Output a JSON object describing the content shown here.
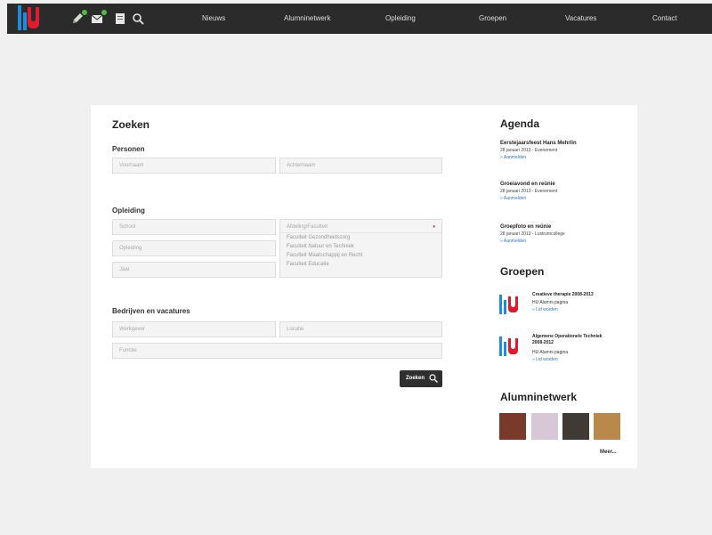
{
  "nav": {
    "logo": "hu-logo",
    "tools": [
      {
        "icon": "pencil-icon"
      },
      {
        "icon": "mail-icon"
      },
      {
        "icon": "book-icon"
      },
      {
        "icon": "search-icon"
      }
    ],
    "items": [
      "Nieuws",
      "Alumninetwerk",
      "Opleiding",
      "Groepen",
      "Vacatures",
      "Contact"
    ]
  },
  "search": {
    "title": "Zoeken",
    "persons": {
      "heading": "Personen",
      "firstname_placeholder": "Voornaam",
      "lastname_placeholder": "Achternaam"
    },
    "education": {
      "heading": "Opleiding",
      "school_placeholder": "School",
      "program_placeholder": "Opleiding",
      "year_placeholder": "Jaar",
      "faculty_placeholder": "Afdeling/Faculteit",
      "faculty_options": [
        "Faculteit Gezondheidszorg",
        "Faculteit Natuur en Techniek",
        "Faculteit Maatschappij en Recht",
        "Faculteit Educatie"
      ]
    },
    "companies": {
      "heading": "Bedrijven en vacatures",
      "company_placeholder": "Werkgever",
      "location_placeholder": "Locatie",
      "function_placeholder": "Functie"
    },
    "button_label": "Zoeken"
  },
  "agenda": {
    "title": "Agenda",
    "items": [
      {
        "title": "Eerstejaarsfeest Hans Mehrlin",
        "date": "28 januari 2013 - Evenement",
        "link": "» Aanmelden"
      },
      {
        "title": "Groeiavond en reünie",
        "date": "28 januari 2013 - Evenement",
        "link": "» Aanmelden"
      },
      {
        "title": "Groepfoto en reünie",
        "date": "28 januari 2013 - Lustrumcollege",
        "link": "» Aanmelden"
      }
    ]
  },
  "groups": {
    "title": "Groepen",
    "items": [
      {
        "name": "Creatieve therapie 2008-2013",
        "sub": "HU Alumni pagina",
        "link": "» Lid worden"
      },
      {
        "name": "Algemene Operationele Techniek 2008-2012",
        "sub": "HU Alumni pagina",
        "link": "» Lid worden"
      }
    ]
  },
  "alumni": {
    "title": "Alumninetwerk",
    "more": "Meer...",
    "thumb_colors": [
      "#7a3a2a",
      "#d8c7d6",
      "#3f3a33",
      "#b8894a"
    ]
  }
}
